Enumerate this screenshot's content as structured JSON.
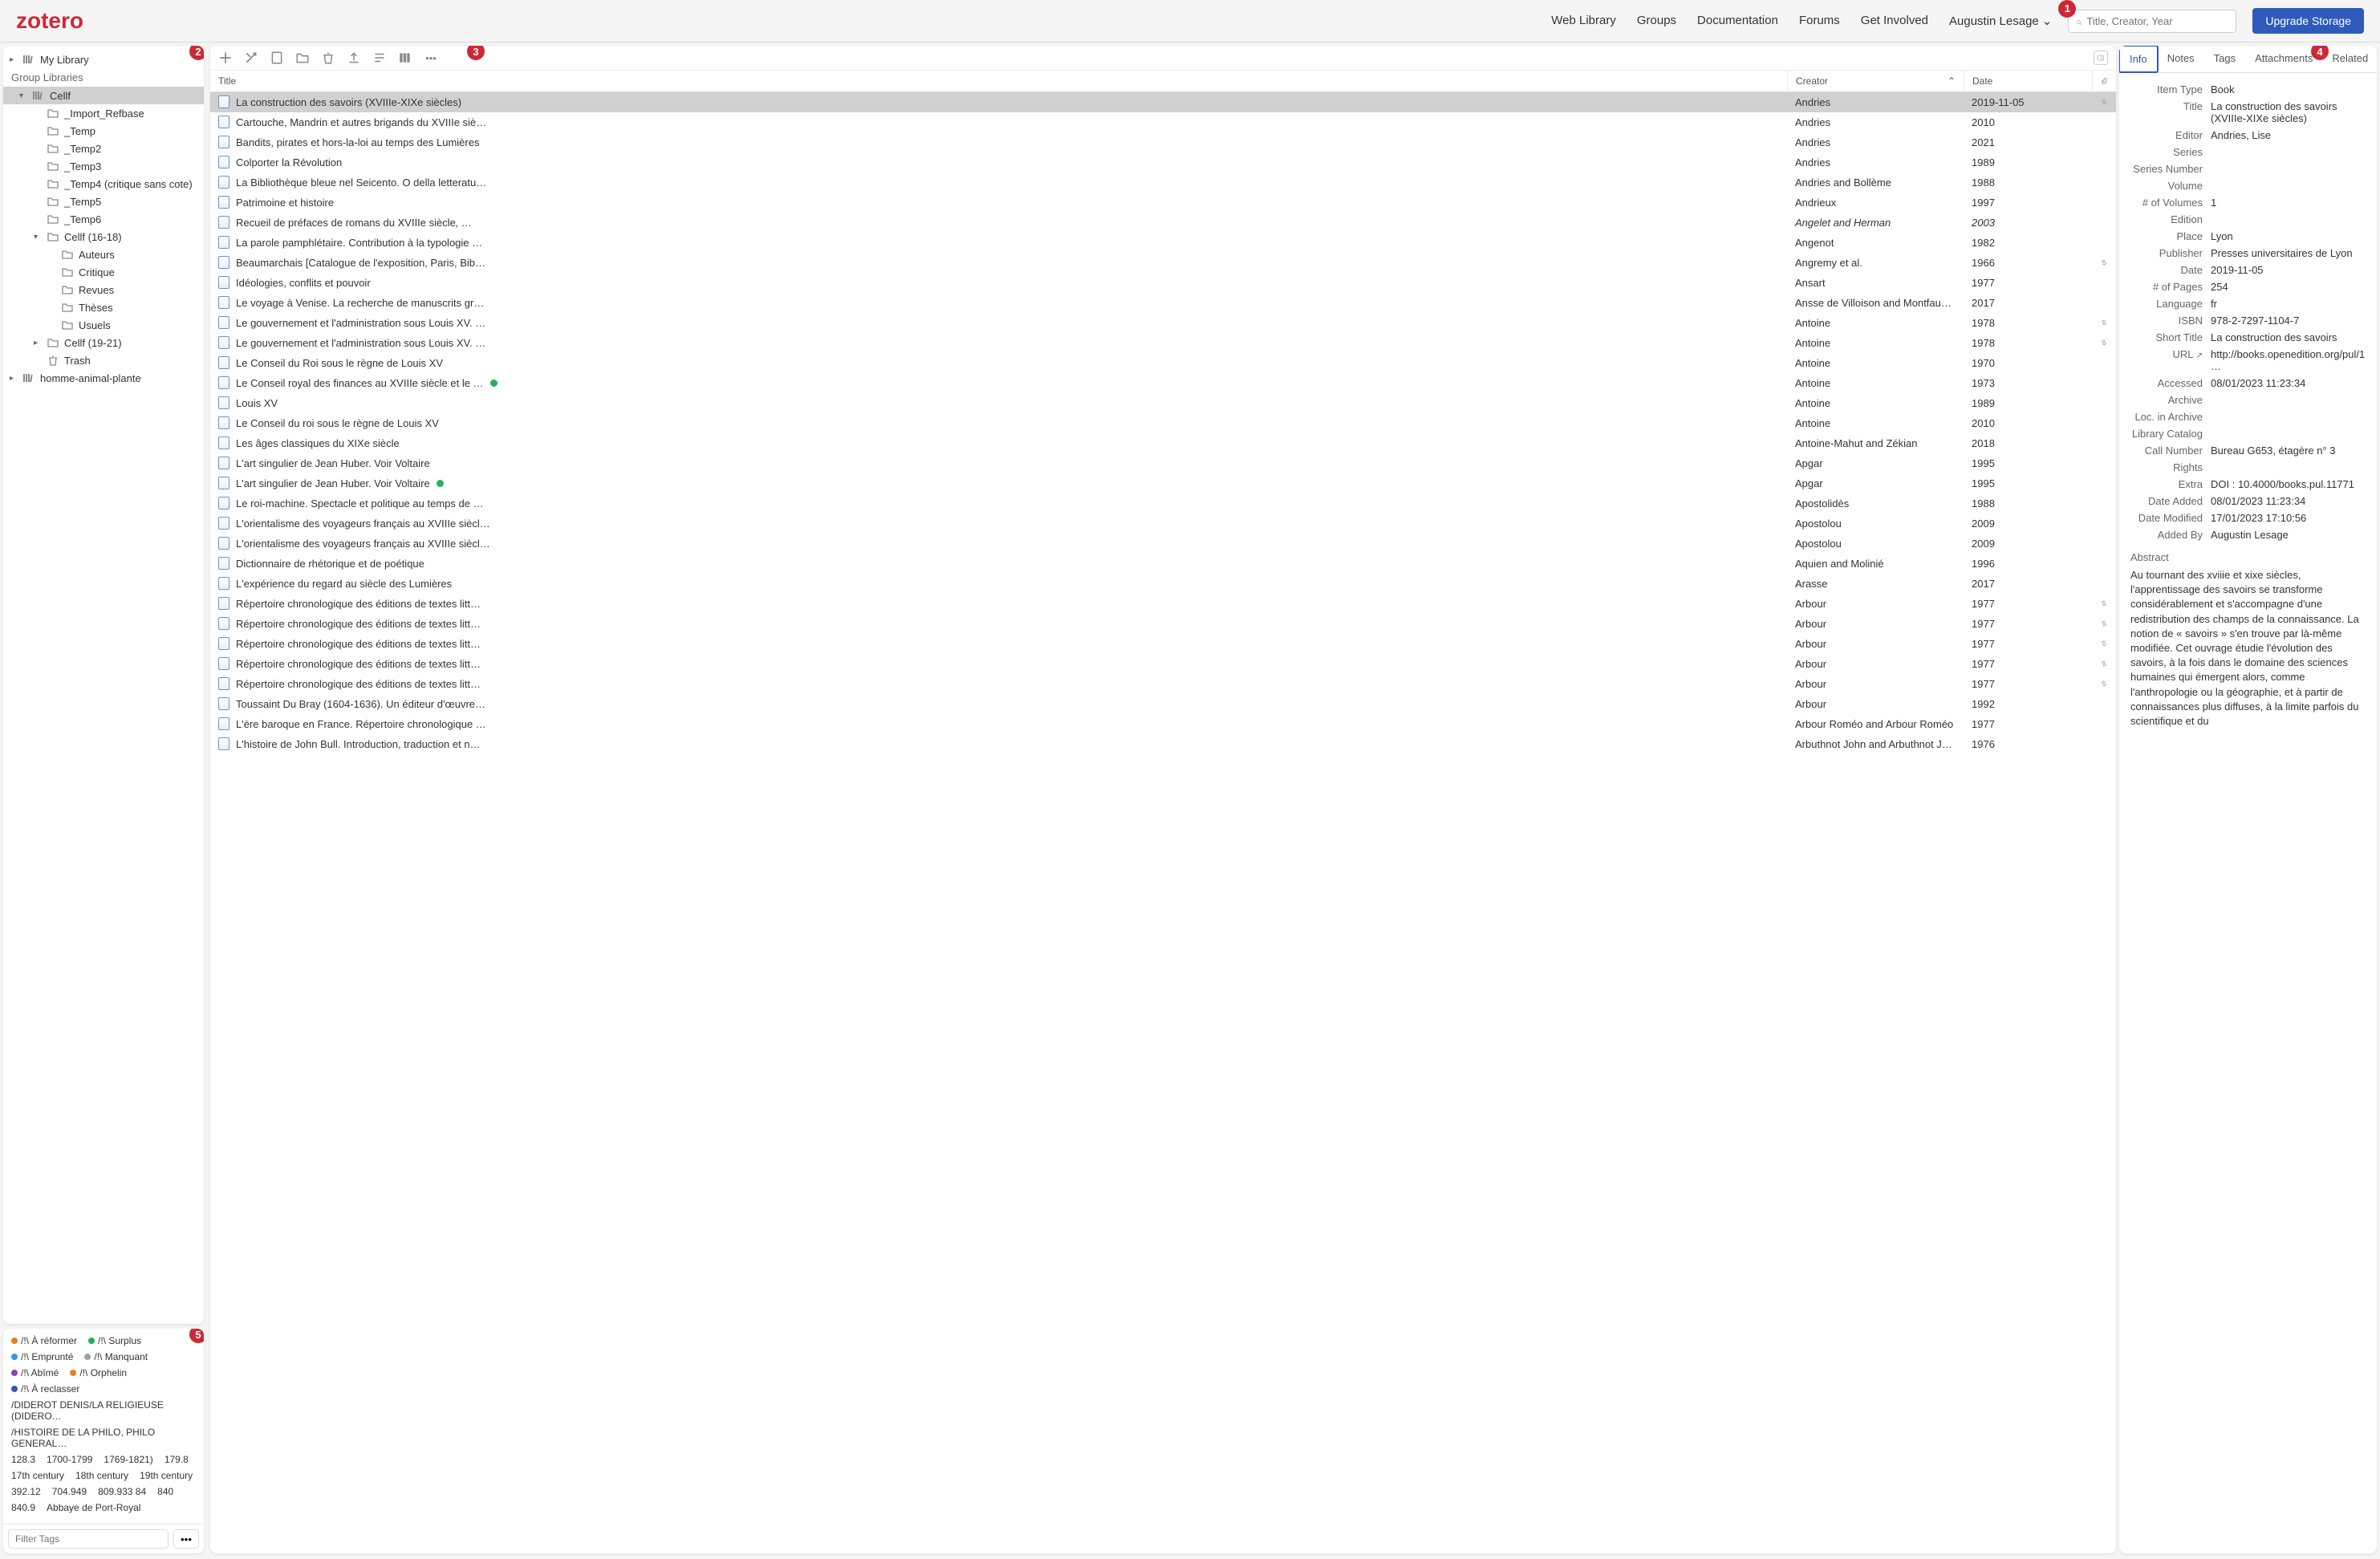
{
  "topbar": {
    "logo": "zotero",
    "nav": [
      "Web Library",
      "Groups",
      "Documentation",
      "Forums",
      "Get Involved"
    ],
    "user": "Augustin Lesage",
    "search_placeholder": "Title, Creator, Year",
    "upgrade": "Upgrade Storage"
  },
  "badges": [
    "1",
    "2",
    "3",
    "4",
    "5"
  ],
  "library": {
    "my_library": "My Library",
    "group_header": "Group Libraries",
    "tree": [
      {
        "label": "Cellf",
        "icon": "library",
        "indent": 1,
        "selected": true,
        "toggle": "▾"
      },
      {
        "label": "_Import_Refbase",
        "icon": "folder",
        "indent": 2
      },
      {
        "label": "_Temp",
        "icon": "folder",
        "indent": 2
      },
      {
        "label": "_Temp2",
        "icon": "folder",
        "indent": 2
      },
      {
        "label": "_Temp3",
        "icon": "folder",
        "indent": 2
      },
      {
        "label": "_Temp4 (critique sans cote)",
        "icon": "folder",
        "indent": 2
      },
      {
        "label": "_Temp5",
        "icon": "folder",
        "indent": 2
      },
      {
        "label": "_Temp6",
        "icon": "folder",
        "indent": 2
      },
      {
        "label": "Cellf (16-18)",
        "icon": "folder",
        "indent": 2,
        "toggle": "▾"
      },
      {
        "label": "Auteurs",
        "icon": "folder",
        "indent": 3
      },
      {
        "label": "Critique",
        "icon": "folder",
        "indent": 3
      },
      {
        "label": "Revues",
        "icon": "folder",
        "indent": 3
      },
      {
        "label": "Thèses",
        "icon": "folder",
        "indent": 3
      },
      {
        "label": "Usuels",
        "icon": "folder",
        "indent": 3
      },
      {
        "label": "Cellf (19-21)",
        "icon": "folder",
        "indent": 2,
        "toggle": "▸"
      },
      {
        "label": "Trash",
        "icon": "trash",
        "indent": 2
      }
    ],
    "other_lib": {
      "label": "homme-animal-plante",
      "icon": "library",
      "toggle": "▸"
    }
  },
  "tags": {
    "colored": [
      {
        "label": "/!\\ À réformer",
        "color": "#e67e22"
      },
      {
        "label": "/!\\ Surplus",
        "color": "#27ae60"
      },
      {
        "label": "/!\\ Emprunté",
        "color": "#3498db"
      },
      {
        "label": "/!\\ Manquant",
        "color": "#95a5a6"
      },
      {
        "label": "/!\\ Abîmé",
        "color": "#8e44ad"
      },
      {
        "label": "/!\\ Orphelin",
        "color": "#e67e22"
      },
      {
        "label": "/!\\ À reclasser",
        "color": "#2e5bba"
      }
    ],
    "plain": [
      "/DIDEROT DENIS/LA RELIGIEUSE (DIDERO…",
      "/HISTOIRE DE LA PHILO, PHILO GENERAL…",
      "128.3",
      "1700-1799",
      "1769-1821)",
      "179.8",
      "17th century",
      "18th century",
      "19th century",
      "392.12",
      "704.949",
      "809.933 84",
      "840",
      "840.9",
      "Abbaye de Port-Royal"
    ],
    "filter_placeholder": "Filter Tags",
    "menu": "•••"
  },
  "table": {
    "headers": {
      "title": "Title",
      "creator": "Creator",
      "date": "Date"
    },
    "sort_indicator": "⌃",
    "rows": [
      {
        "title": "La construction des savoirs (XVIIIe-XIXe siècles)",
        "creator": "Andries",
        "date": "2019-11-05",
        "attach": true,
        "selected": true
      },
      {
        "title": "Cartouche, Mandrin et autres brigands du XVIIIe siè…",
        "creator": "Andries",
        "date": "2010"
      },
      {
        "title": "Bandits, pirates et hors-la-loi au temps des Lumières",
        "creator": "Andries",
        "date": "2021"
      },
      {
        "title": "Colporter la Révolution",
        "creator": "Andries",
        "date": "1989"
      },
      {
        "title": "La Bibliothèque bleue nel Seicento. O della letteratu…",
        "creator": "Andries and Bollème",
        "date": "1988"
      },
      {
        "title": "Patrimoine et histoire",
        "creator": "Andrieux",
        "date": "1997"
      },
      {
        "title": "Recueil de préfaces de romans du XVIIIe siècle<i>, …",
        "creator": "Angelet and Herman",
        "date": "2003"
      },
      {
        "title": "La parole pamphlétaire. Contribution à la typologie …",
        "creator": "Angenot",
        "date": "1982"
      },
      {
        "title": "Beaumarchais [Catalogue de l'exposition, Paris, Bib…",
        "creator": "Angremy et al.",
        "date": "1966",
        "attach": true
      },
      {
        "title": "Idéologies, conflits et pouvoir",
        "creator": "Ansart",
        "date": "1977"
      },
      {
        "title": "Le voyage à Venise. La recherche de manuscrits gr…",
        "creator": "Ansse de Villoison and Montfaucon",
        "date": "2017"
      },
      {
        "title": "Le gouvernement et l'administration sous Louis XV. …",
        "creator": "Antoine",
        "date": "1978",
        "attach": true
      },
      {
        "title": "Le gouvernement et l'administration sous Louis XV. …",
        "creator": "Antoine",
        "date": "1978",
        "attach": true
      },
      {
        "title": "Le Conseil du Roi sous le règne de Louis XV",
        "creator": "Antoine",
        "date": "1970"
      },
      {
        "title": "Le Conseil royal des finances au XVIIIe siècle et le …",
        "creator": "Antoine",
        "date": "1973",
        "dot": "#27ae60"
      },
      {
        "title": "Louis XV",
        "creator": "Antoine",
        "date": "1989"
      },
      {
        "title": "Le Conseil du roi sous le règne de Louis XV",
        "creator": "Antoine",
        "date": "2010"
      },
      {
        "title": "Les âges classiques du XIXe siècle",
        "creator": "Antoine-Mahut and Zékian",
        "date": "2018"
      },
      {
        "title": "L'art singulier de Jean Huber. Voir Voltaire",
        "creator": "Apgar",
        "date": "1995"
      },
      {
        "title": "L'art singulier de Jean Huber. Voir Voltaire",
        "creator": "Apgar",
        "date": "1995",
        "dot": "#27ae60"
      },
      {
        "title": "Le roi-machine. Spectacle et politique au temps de …",
        "creator": "Apostolidès",
        "date": "1988"
      },
      {
        "title": "L'orientalisme des voyageurs français au XVIIIe siècl…",
        "creator": "Apostolou",
        "date": "2009"
      },
      {
        "title": "L'orientalisme des voyageurs français au XVIIIe siècl…",
        "creator": "Apostolou",
        "date": "2009"
      },
      {
        "title": "Dictionnaire de rhétorique et de poétique",
        "creator": "Aquien and Molinié",
        "date": "1996"
      },
      {
        "title": "L'expérience du regard au siècle des Lumières",
        "creator": "Arasse",
        "date": "2017"
      },
      {
        "title": "Répertoire chronologique des éditions de textes litt…",
        "creator": "Arbour",
        "date": "1977",
        "attach": true
      },
      {
        "title": "Répertoire chronologique des éditions de textes litt…",
        "creator": "Arbour",
        "date": "1977",
        "attach": true
      },
      {
        "title": "Répertoire chronologique des éditions de textes litt…",
        "creator": "Arbour",
        "date": "1977",
        "attach": true
      },
      {
        "title": "Répertoire chronologique des éditions de textes litt…",
        "creator": "Arbour",
        "date": "1977",
        "attach": true
      },
      {
        "title": "Répertoire chronologique des éditions de textes litt…",
        "creator": "Arbour",
        "date": "1977",
        "attach": true
      },
      {
        "title": "Toussaint Du Bray (1604-1636). Un éditeur d'œuvre…",
        "creator": "Arbour",
        "date": "1992"
      },
      {
        "title": "L'ère baroque en France. Répertoire chronologique …",
        "creator": "Arbour Roméo and Arbour Roméo",
        "date": "1977"
      },
      {
        "title": "L'histoire de John Bull. Introduction, traduction et n…",
        "creator": "Arbuthnot John and Arbuthnot John",
        "date": "1976"
      }
    ]
  },
  "info": {
    "tabs": [
      "Info",
      "Notes",
      "Tags",
      "Attachments",
      "Related"
    ],
    "active_tab": 0,
    "fields": [
      {
        "label": "Item Type",
        "value": "Book"
      },
      {
        "label": "Title",
        "value": "La construction des savoirs (XVIIIe-XIXe siècles)"
      },
      {
        "label": "Editor",
        "value": "Andries, Lise"
      },
      {
        "label": "Series",
        "value": ""
      },
      {
        "label": "Series Number",
        "value": ""
      },
      {
        "label": "Volume",
        "value": ""
      },
      {
        "label": "# of Volumes",
        "value": "1"
      },
      {
        "label": "Edition",
        "value": ""
      },
      {
        "label": "Place",
        "value": "Lyon"
      },
      {
        "label": "Publisher",
        "value": "Presses universitaires de Lyon"
      },
      {
        "label": "Date",
        "value": "2019-11-05"
      },
      {
        "label": "# of Pages",
        "value": "254"
      },
      {
        "label": "Language",
        "value": "fr"
      },
      {
        "label": "ISBN",
        "value": "978-2-7297-1104-7"
      },
      {
        "label": "Short Title",
        "value": "La construction des savoirs"
      },
      {
        "label": "URL",
        "value": "http://books.openedition.org/pul/1…",
        "link": true
      },
      {
        "label": "Accessed",
        "value": "08/01/2023 11:23:34"
      },
      {
        "label": "Archive",
        "value": ""
      },
      {
        "label": "Loc. in Archive",
        "value": ""
      },
      {
        "label": "Library Catalog",
        "value": ""
      },
      {
        "label": "Call Number",
        "value": "Bureau G653, étagère n° 3"
      },
      {
        "label": "Rights",
        "value": ""
      },
      {
        "label": "Extra",
        "value": "DOI : 10.4000/books.pul.11771"
      },
      {
        "label": "Date Added",
        "value": "08/01/2023 11:23:34"
      },
      {
        "label": "Date Modified",
        "value": "17/01/2023 17:10:56"
      },
      {
        "label": "Added By",
        "value": "Augustin Lesage"
      }
    ],
    "abstract_label": "Abstract",
    "abstract": "Au tournant des xviiie et xixe siècles, l'apprentissage des savoirs se transforme considérablement et s'accompagne d'une redistribution des champs de la connaissance. La notion de « savoirs » s'en trouve par là-même modifiée. Cet ouvrage étudie l'évolution des savoirs, à la fois dans le domaine des sciences humaines qui émergent alors, comme l'anthropologie ou la géographie, et à partir de connaissances plus diffuses, à la limite parfois du scientifique et du"
  }
}
